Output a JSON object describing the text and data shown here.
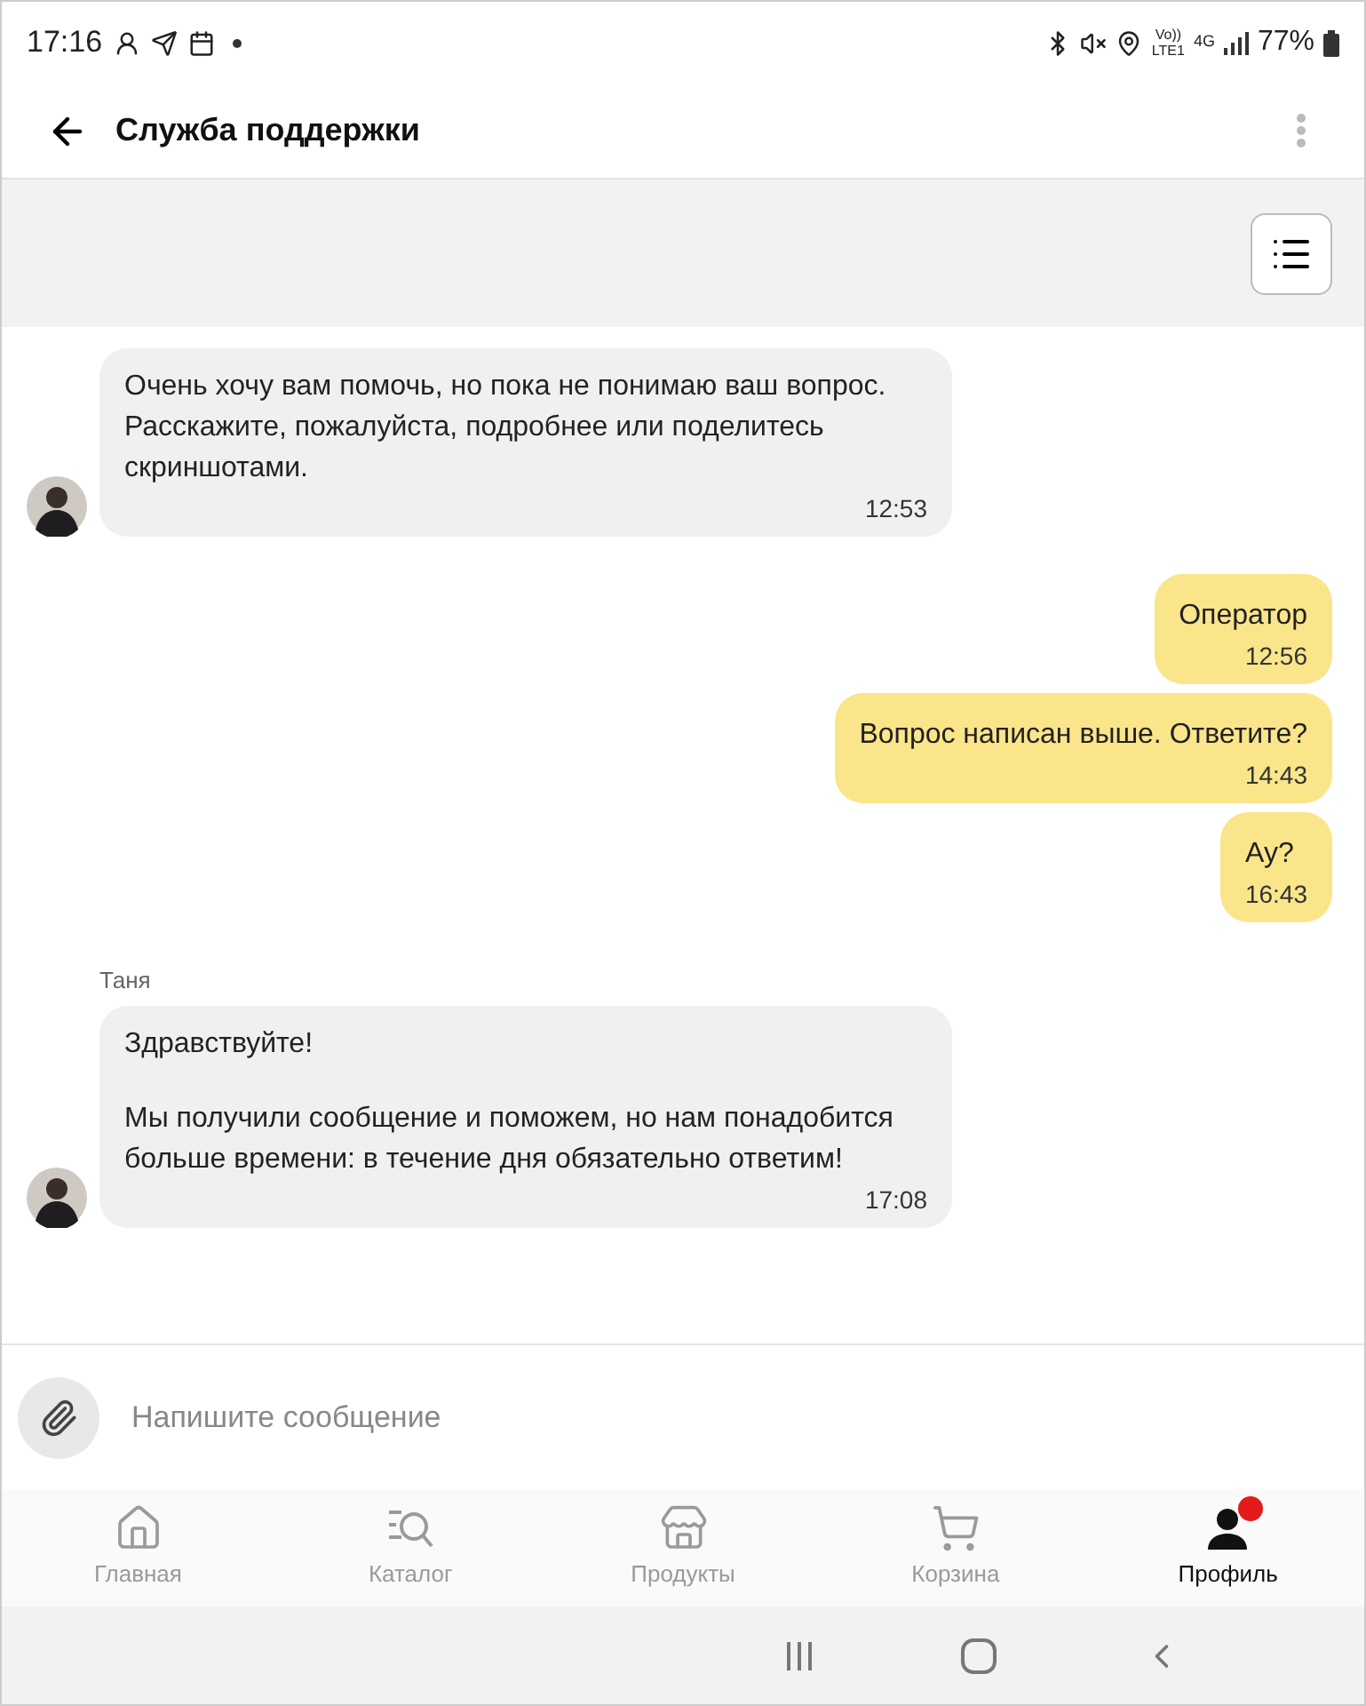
{
  "status_bar": {
    "time": "17:16",
    "volte": "Vo))",
    "lte": "LTE1",
    "network": "4G",
    "battery": "77%"
  },
  "header": {
    "title": "Служба поддержки"
  },
  "messages": [
    {
      "kind": "incoming",
      "paragraphs": [
        "Очень хочу вам помочь, но пока не понимаю ваш вопрос. Расскажите, пожалуйста, подробнее или поделитесь скриншотами."
      ],
      "time": "12:53"
    },
    {
      "kind": "outgoing",
      "paragraphs": [
        "Оператор"
      ],
      "time": "12:56"
    },
    {
      "kind": "outgoing",
      "paragraphs": [
        "Вопрос написан выше. Ответите?"
      ],
      "time": "14:43"
    },
    {
      "kind": "outgoing",
      "paragraphs": [
        "Ау?"
      ],
      "time": "16:43"
    },
    {
      "kind": "incoming",
      "author": "Таня",
      "paragraphs": [
        "Здравствуйте!",
        "Мы получили сообщение и поможем, но нам понадобится больше времени: в течение дня обязательно ответим!"
      ],
      "time": "17:08"
    }
  ],
  "composer": {
    "placeholder": "Напишите сообщение"
  },
  "tabs": [
    {
      "label": "Главная",
      "selected": false,
      "badge": false
    },
    {
      "label": "Каталог",
      "selected": false,
      "badge": false
    },
    {
      "label": "Продукты",
      "selected": false,
      "badge": false
    },
    {
      "label": "Корзина",
      "selected": false,
      "badge": false
    },
    {
      "label": "Профиль",
      "selected": true,
      "badge": true
    }
  ]
}
